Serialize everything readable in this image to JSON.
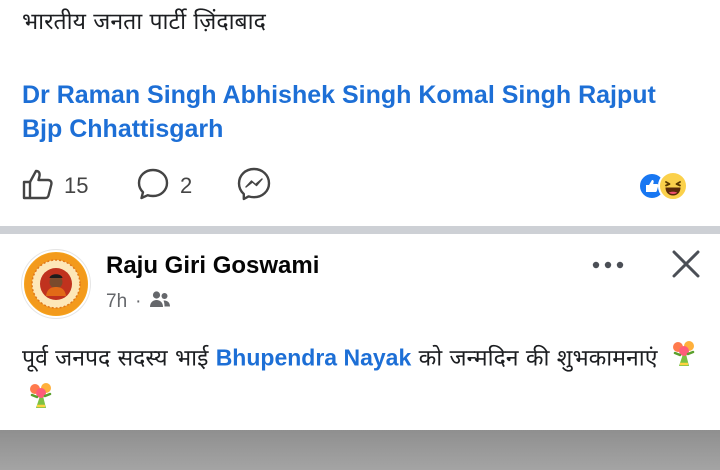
{
  "post1": {
    "text": "भारतीय जनता पार्टी ज़िंदाबाद",
    "tags": [
      "Dr Raman Singh",
      "Abhishek Singh",
      "Komal Singh Rajput",
      "Bjp Chhattisgarh"
    ],
    "like_count": "15",
    "comment_count": "2"
  },
  "post2": {
    "author": "Raju Giri Goswami",
    "time": "7h",
    "text_before": "पूर्व जनपद सदस्य भाई",
    "mention": "Bhupendra Nayak",
    "text_after": "को जन्मदिन की शुभकामनाएं"
  },
  "icons": {
    "like": "thumbs-up-outline-icon",
    "comment": "speech-bubble-icon",
    "share": "messenger-icon",
    "reaction_like": "like-reaction-icon",
    "reaction_haha": "haha-reaction-icon",
    "audience": "friends-icon",
    "more": "more-dots-icon",
    "close": "close-x-icon",
    "emoji": "bouquet-icon"
  },
  "colors": {
    "link": "#1d6fd6",
    "like_reaction": "#1877f2",
    "haha_reaction": "#fbd14b",
    "divider": "#cdd0d5",
    "meta": "#65676b"
  }
}
